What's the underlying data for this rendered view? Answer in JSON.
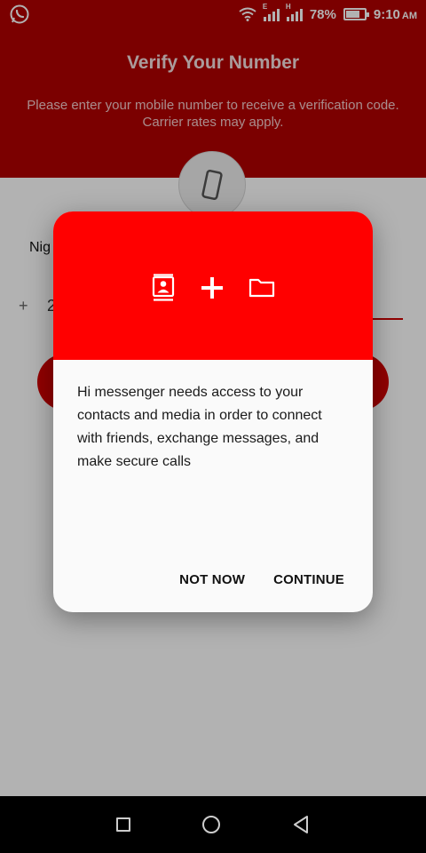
{
  "status_bar": {
    "battery": "78%",
    "battery_fraction": 0.78,
    "time": "9:10",
    "ampm": "AM",
    "sim1_label": "E",
    "sim2_label": "H"
  },
  "header": {
    "title": "Verify Your Number",
    "subtitle": "Please enter your mobile number to receive a verification code. Carrier rates may apply."
  },
  "form": {
    "country": "Nig",
    "plus": "+",
    "code": "2"
  },
  "dialog": {
    "icons": [
      "contacts-icon",
      "plus-icon",
      "folder-icon"
    ],
    "message": "Hi messenger needs access to your contacts and media in order to connect with friends, exchange messages, and make secure calls",
    "not_now": "NOT NOW",
    "continue": "CONTINUE"
  },
  "colors": {
    "brand_red": "#b00000",
    "dialog_red": "#ff0000"
  }
}
